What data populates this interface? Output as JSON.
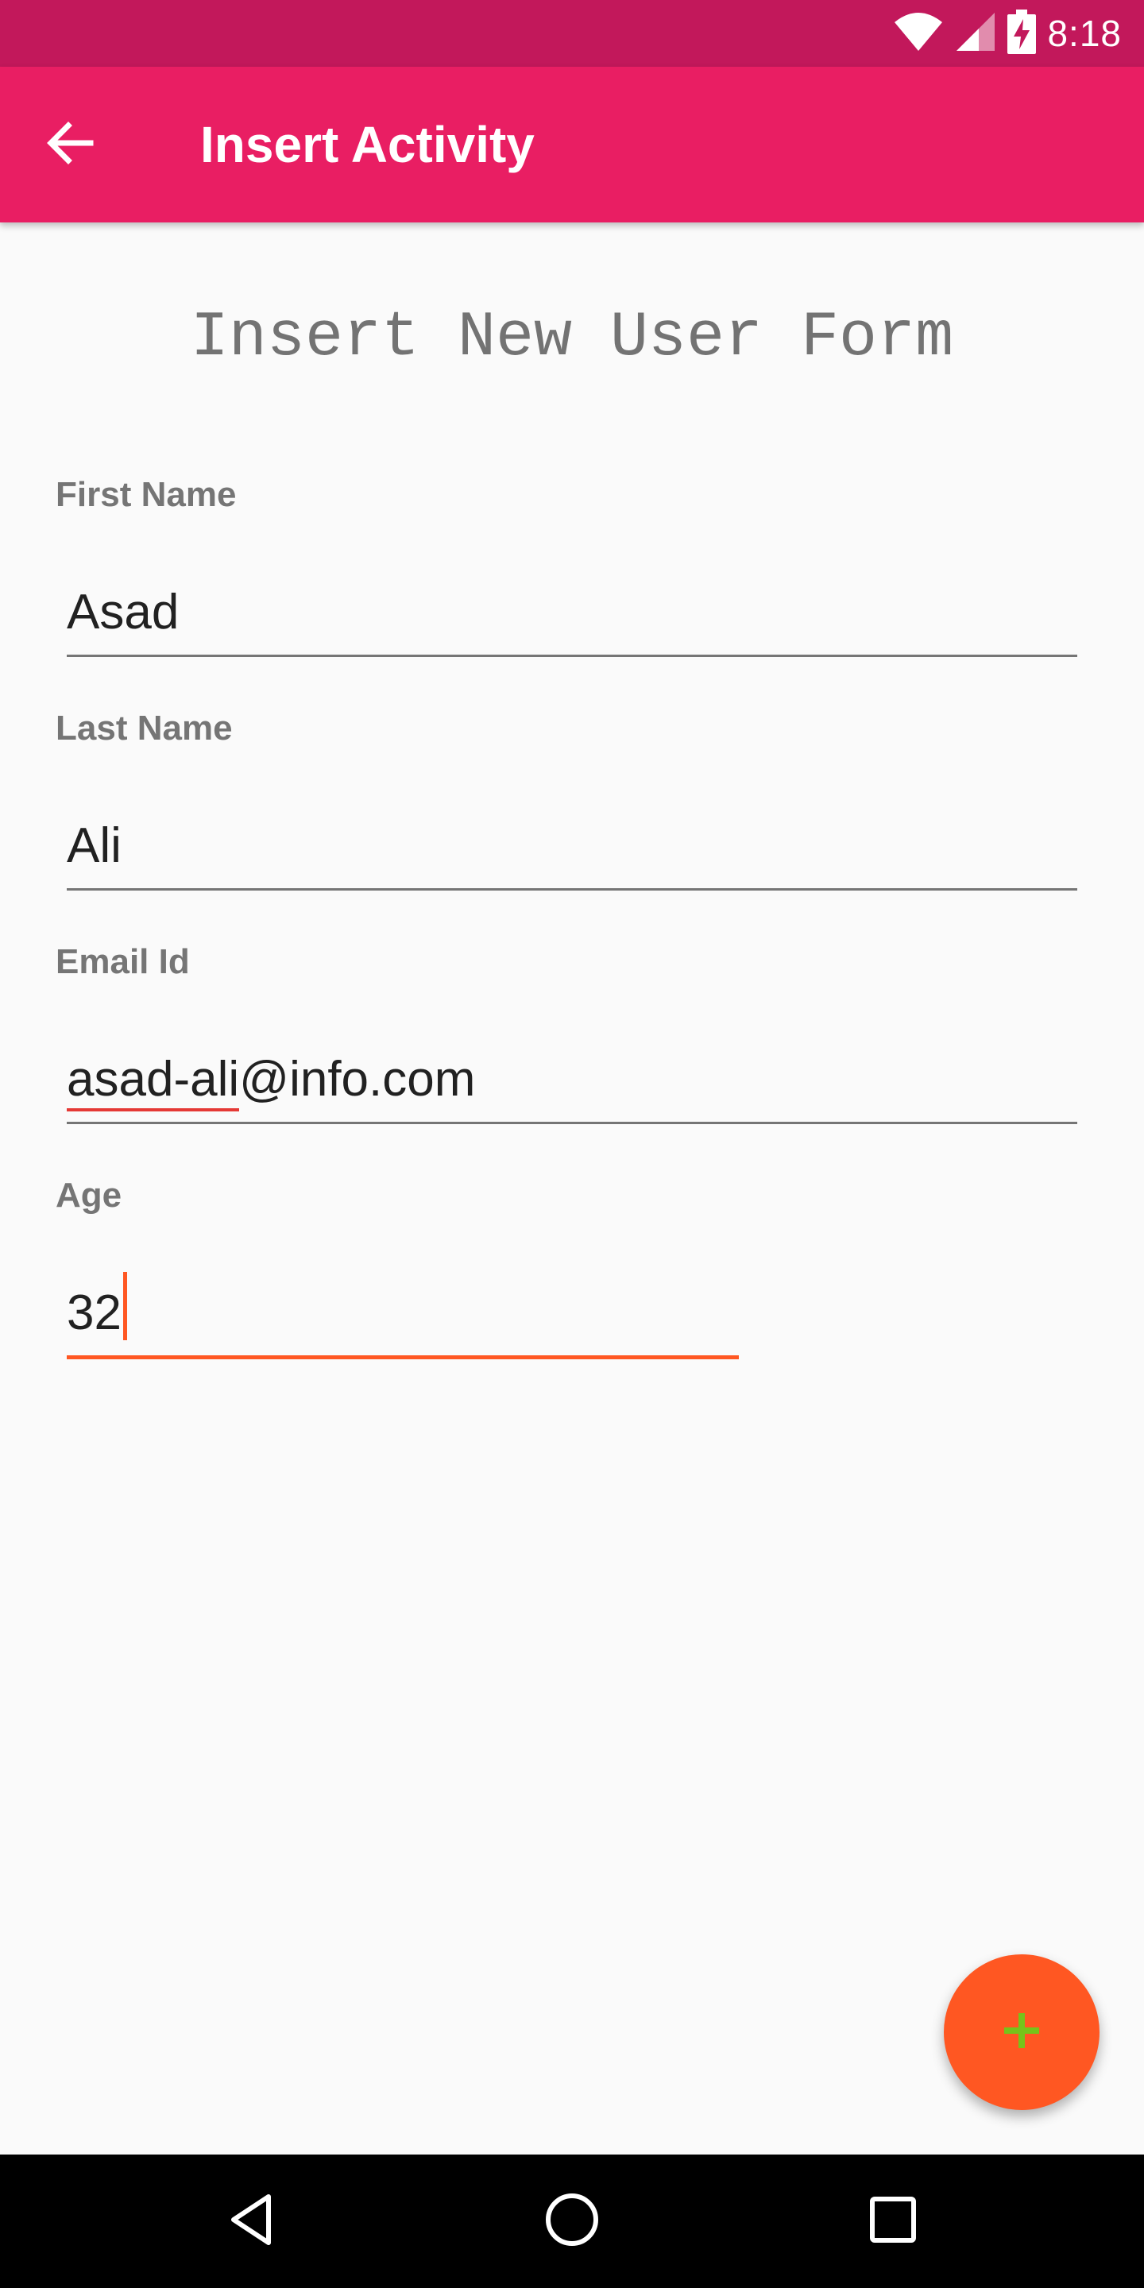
{
  "status_bar": {
    "time": "8:18",
    "icons": [
      "wifi-icon",
      "cell-signal-icon",
      "battery-charging-icon"
    ]
  },
  "app_bar": {
    "title": "Insert Activity",
    "back_icon": "arrow-back-icon"
  },
  "form": {
    "heading": "Insert New User Form",
    "fields": [
      {
        "label": "First Name",
        "value": "Asad"
      },
      {
        "label": "Last Name",
        "value": "Ali"
      },
      {
        "label": "Email Id",
        "value_underlined": "asad-ali",
        "value_rest": "@info.com"
      },
      {
        "label": "Age",
        "value": "32"
      }
    ]
  },
  "fab": {
    "icon": "plus-icon",
    "background": "#ff5722",
    "icon_color": "#76c31a"
  },
  "navigation_bar": {
    "icons": [
      "back-triangle-icon",
      "home-circle-icon",
      "recents-square-icon"
    ]
  },
  "colors": {
    "status_bar": "#c2185b",
    "app_bar": "#e91e63",
    "accent": "#ff5722",
    "spellcheck": "#e53935"
  }
}
